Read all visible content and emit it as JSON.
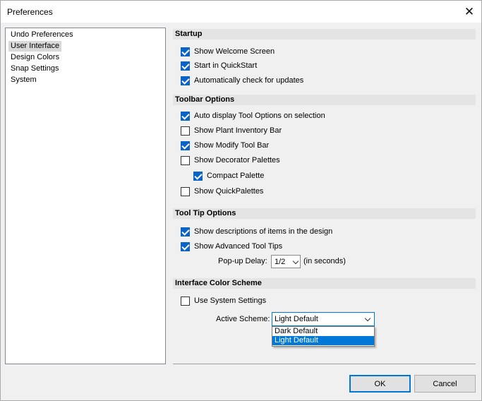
{
  "window": {
    "title": "Preferences",
    "close_glyph": "✕"
  },
  "nav": {
    "items": [
      {
        "label": "Undo Preferences",
        "selected": false
      },
      {
        "label": "User Interface",
        "selected": true
      },
      {
        "label": "Design Colors",
        "selected": false
      },
      {
        "label": "Snap Settings",
        "selected": false
      },
      {
        "label": "System",
        "selected": false
      }
    ]
  },
  "startup": {
    "title": "Startup",
    "options": [
      {
        "label": "Show Welcome Screen",
        "checked": true
      },
      {
        "label": "Start in QuickStart",
        "checked": true
      },
      {
        "label": "Automatically check for updates",
        "checked": true
      }
    ]
  },
  "toolbar_options": {
    "title": "Toolbar Options",
    "options": [
      {
        "label": "Auto display Tool Options on selection",
        "checked": true
      },
      {
        "label": "Show Plant Inventory Bar",
        "checked": false
      },
      {
        "label": "Show Modify Tool Bar",
        "checked": true
      },
      {
        "label": "Show Decorator Palettes",
        "checked": false
      },
      {
        "label": "Compact Palette",
        "checked": true
      },
      {
        "label": "Show QuickPalettes",
        "checked": false
      }
    ]
  },
  "tooltip_options": {
    "title": "Tool Tip Options",
    "options": [
      {
        "label": "Show descriptions of items in the design",
        "checked": true
      },
      {
        "label": "Show Advanced Tool Tips",
        "checked": true
      }
    ],
    "popup_delay_label": "Pop-up Delay:",
    "popup_delay_value": "1/2",
    "popup_delay_unit": "(in seconds)"
  },
  "color_scheme": {
    "title": "Interface Color Scheme",
    "use_system_label": "Use System Settings",
    "use_system_checked": false,
    "active_label": "Active Scheme:",
    "active_value": "Light Default",
    "options": [
      "Dark Default",
      "Light Default"
    ],
    "selected_option": "Light Default"
  },
  "buttons": {
    "ok": "OK",
    "cancel": "Cancel"
  }
}
